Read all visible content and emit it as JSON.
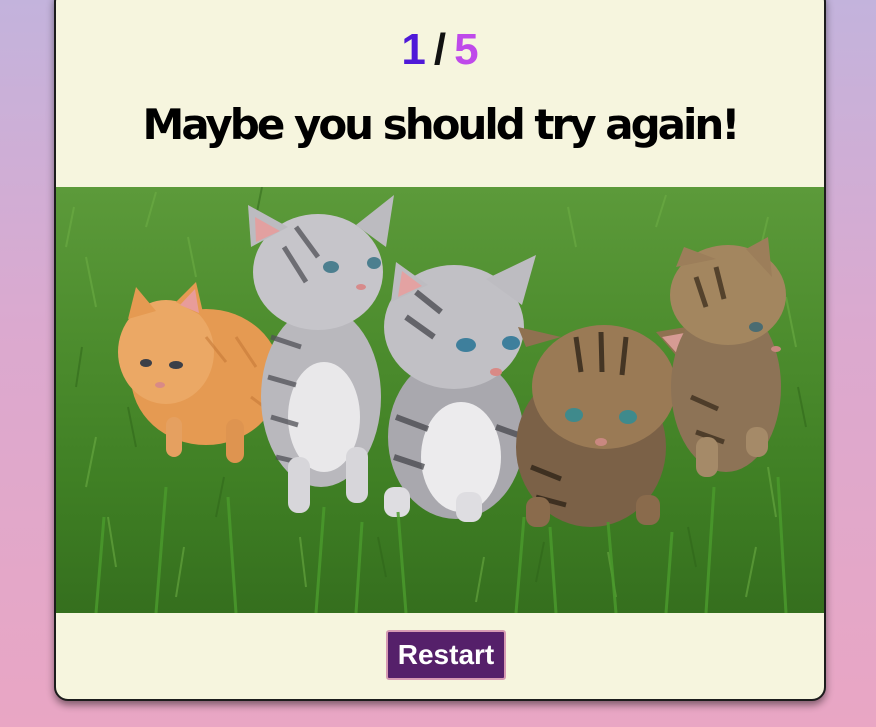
{
  "quiz": {
    "score_current": "1",
    "score_separator": "/",
    "score_total": "5",
    "result_message": "Maybe you should try again!"
  },
  "image": {
    "subject": "five kittens sitting on grass",
    "icon": "kittens-photo"
  },
  "actions": {
    "restart_label": "Restart"
  },
  "colors": {
    "score_current": "#4f19d8",
    "score_total": "#bf49ea",
    "card_background": "#f6f5de",
    "button_background": "#55206a",
    "button_border": "#d69ab3"
  }
}
